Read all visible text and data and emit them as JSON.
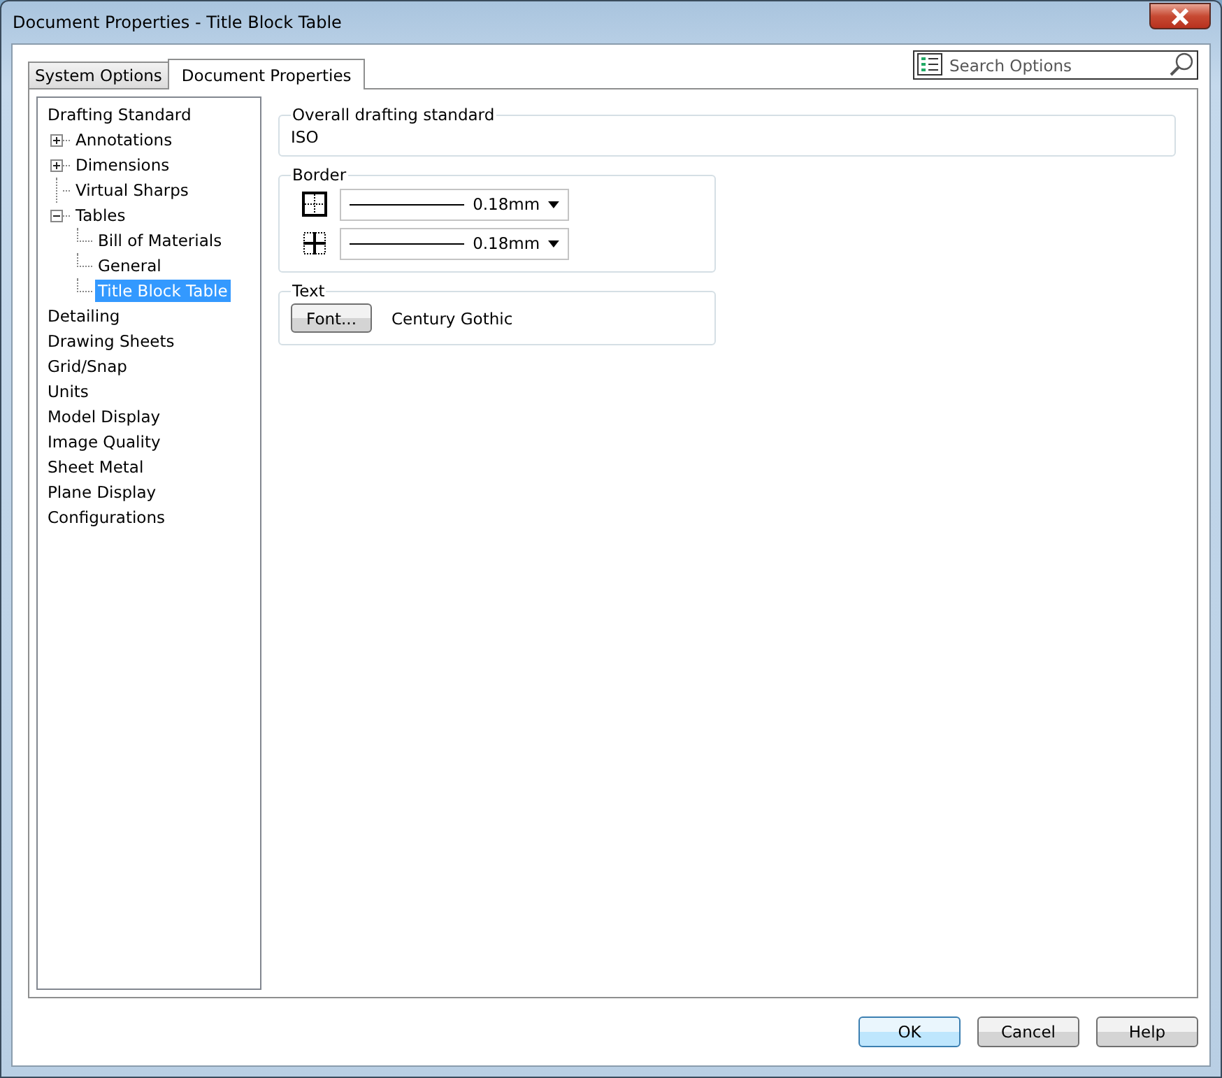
{
  "window": {
    "title": "Document Properties - Title Block Table"
  },
  "tabs": [
    {
      "label": "System Options",
      "selected": false
    },
    {
      "label": "Document Properties",
      "selected": true
    }
  ],
  "search": {
    "placeholder": "Search Options"
  },
  "tree": [
    {
      "label": "Drafting Standard",
      "selected": false,
      "children": [
        {
          "label": "Annotations",
          "kind": "folder",
          "expanded": false,
          "selected": false
        },
        {
          "label": "Dimensions",
          "kind": "folder",
          "expanded": false,
          "selected": false
        },
        {
          "label": "Virtual Sharps",
          "kind": "leaf",
          "selected": false
        },
        {
          "label": "Tables",
          "kind": "folder",
          "expanded": true,
          "selected": false,
          "children": [
            {
              "label": "Bill of Materials",
              "selected": false
            },
            {
              "label": "General",
              "selected": false
            },
            {
              "label": "Title Block Table",
              "selected": true
            }
          ]
        }
      ]
    },
    {
      "label": "Detailing",
      "selected": false
    },
    {
      "label": "Drawing Sheets",
      "selected": false
    },
    {
      "label": "Grid/Snap",
      "selected": false
    },
    {
      "label": "Units",
      "selected": false
    },
    {
      "label": "Model Display",
      "selected": false
    },
    {
      "label": "Image Quality",
      "selected": false
    },
    {
      "label": "Sheet Metal",
      "selected": false
    },
    {
      "label": "Plane Display",
      "selected": false
    },
    {
      "label": "Configurations",
      "selected": false
    }
  ],
  "overall_standard": {
    "label": "Overall drafting standard",
    "value": "ISO"
  },
  "border": {
    "label": "Border",
    "rows": [
      {
        "kind": "outer",
        "value": "0.18mm"
      },
      {
        "kind": "inner",
        "value": "0.18mm"
      }
    ]
  },
  "text": {
    "label": "Text",
    "button": "Font...",
    "font": "Century Gothic"
  },
  "buttons": [
    {
      "label": "OK",
      "default": true
    },
    {
      "label": "Cancel",
      "default": false
    },
    {
      "label": "Help",
      "default": false
    }
  ]
}
